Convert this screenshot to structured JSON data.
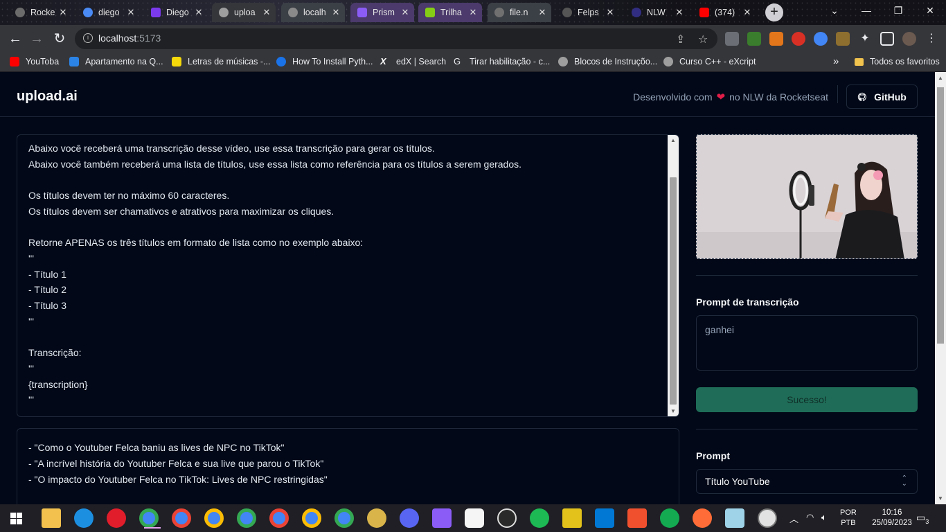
{
  "browser": {
    "tabs": [
      {
        "title": "Rocke",
        "color": "#6b6b6b"
      },
      {
        "title": "diego",
        "color": "#4a8af4"
      },
      {
        "title": "Diego",
        "color": "#7c3aed"
      },
      {
        "title": "uploa",
        "color": "#9e9e9e"
      },
      {
        "title": "localh",
        "color": "#9e9e9e"
      },
      {
        "title": "Prism",
        "color": "#8b5cf6"
      },
      {
        "title": "Trilha",
        "color": "#84cc16"
      },
      {
        "title": "file.n",
        "color": "#9e9e9e"
      },
      {
        "title": "Felps",
        "color": "#9e9e9e"
      },
      {
        "title": "NLW",
        "color": "#312e81"
      },
      {
        "title": "(374)",
        "color": "#ff0000"
      }
    ],
    "url_host": "localhost",
    "url_port": ":5173",
    "bookmarks": [
      {
        "label": "YouToba",
        "color": "#ff0000"
      },
      {
        "label": "Apartamento na Q...",
        "color": "#2b83e6"
      },
      {
        "label": "Letras de músicas -...",
        "color": "#f5d90a"
      },
      {
        "label": "How To Install Pyth...",
        "color": "#1a73e8"
      },
      {
        "label": "edX | Search",
        "color": "#ffffff"
      },
      {
        "label": "Tirar habilitação - c...",
        "color": "#5f6368"
      },
      {
        "label": "Blocos de Instruçõo...",
        "color": "#9e9e9e"
      },
      {
        "label": "Curso C++ - eXcript",
        "color": "#9e9e9e"
      }
    ],
    "bookmarks_all": "Todos os favoritos"
  },
  "app": {
    "logo": "upload.ai",
    "credit_prefix": "Desenvolvido com",
    "credit_suffix": "no NLW da Rocketseat",
    "github_label": "GitHub",
    "prompt_text": "Abaixo você receberá uma transcrição desse vídeo, use essa transcrição para gerar os títulos.\nAbaixo você também receberá uma lista de títulos, use essa lista como referência para os títulos a serem gerados.\n\nOs títulos devem ter no máximo 60 caracteres.\nOs títulos devem ser chamativos e atrativos para maximizar os cliques.\n\nRetorne APENAS os três títulos em formato de lista como no exemplo abaixo:\n'''\n- Título 1\n- Título 2\n- Título 3\n'''\n\nTranscrição:\n'''\n{transcription}\n'''",
    "result_text": "- \"Como o Youtuber Felca baniu as lives de NPC no TikTok\"\n- \"A incrível história do Youtuber Felca e sua live que parou o TikTok\"\n- \"O impacto do Youtuber Felca no TikTok: Lives de NPC restringidas\"",
    "transcription_label": "Prompt de transcrição",
    "transcription_value": "ganhei",
    "success_button": "Sucesso!",
    "prompt_label": "Prompt",
    "prompt_selected": "Título YouTube"
  },
  "taskbar": {
    "lang_1": "POR",
    "lang_2": "PTB",
    "time": "10:16",
    "date": "25/09/2023",
    "notifications": "3"
  }
}
